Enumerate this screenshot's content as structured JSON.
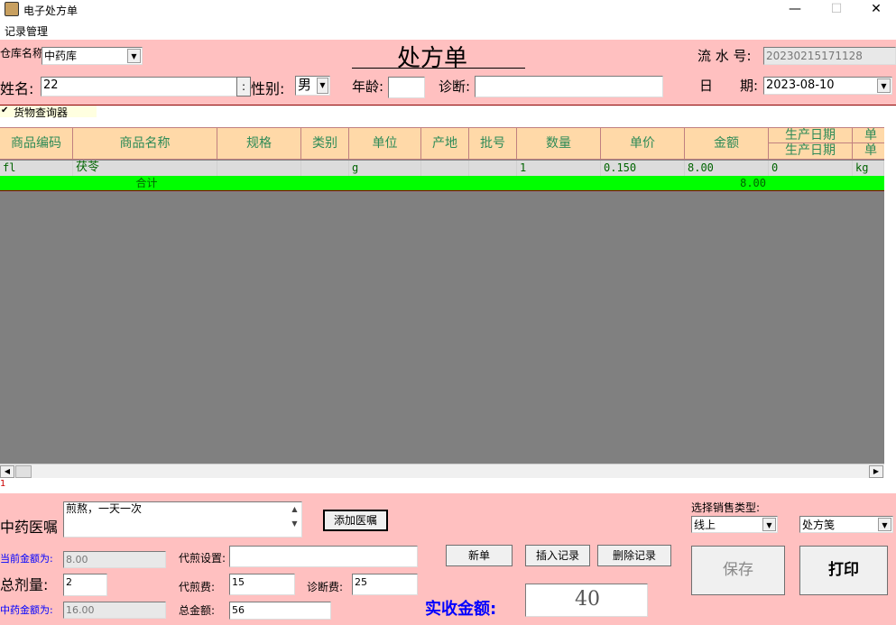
{
  "window": {
    "title": "电子处方单",
    "minimize": "—",
    "maximize": "☐",
    "close": "✕"
  },
  "menu": {
    "item1": "记录管理"
  },
  "form": {
    "warehouse_label": "仓库名称",
    "warehouse_value": "中药库",
    "heading": "处方单",
    "serial_label": "流 水 号:",
    "serial_value": "20230215171128",
    "name_label": "姓名:",
    "name_value": "22",
    "name_btn": ":",
    "gender_label": "性别:",
    "gender_value": "男",
    "age_label": "年龄:",
    "age_value": "",
    "diagnosis_label": "诊断:",
    "diagnosis_value": "",
    "date_label_1": "日",
    "date_label_2": "期:",
    "date_value": "2023-08-10",
    "goods_query_check": "✔",
    "goods_query_label": "货物查询器"
  },
  "grid": {
    "headers": [
      "商品编码",
      "商品名称",
      "规格",
      "类别",
      "单位",
      "产地",
      "批号",
      "数量",
      "单价",
      "金额",
      "生产日期",
      "单"
    ],
    "split_header_top": "生产日期",
    "split_header_bottom": "生产日期",
    "row1": {
      "code": "fl",
      "name": "茯苓",
      "spec": "",
      "category": "",
      "unit": "g",
      "origin": "",
      "batch": "",
      "qty": "1",
      "price": "0.150",
      "amount": "8.00",
      "prod_date": "0",
      "last": "kg"
    },
    "sum_row": {
      "label": "合计",
      "amount": "8.00"
    }
  },
  "marker": "1",
  "bottom": {
    "advice_label": "中药医嘱",
    "advice_text": "煎熬，一天一次",
    "add_advice_btn": "添加医嘱",
    "sale_type_label": "选择销售类型:",
    "sale_type_value": "线上",
    "rx_type_value": "处方笺",
    "current_amount_label": "当前金额为:",
    "current_amount_value": "8.00",
    "decoct_setting_label": "代煎设置:",
    "decoct_setting_value": "",
    "total_dose_label": "总剂量:",
    "total_dose_value": "2",
    "decoct_fee_label": "代煎费:",
    "decoct_fee_value": "15",
    "diag_fee_label": "诊断费:",
    "diag_fee_value": "25",
    "tcm_amount_label": "中药金额为:",
    "tcm_amount_value": "16.00",
    "total_amount_label": "总金额:",
    "total_amount_value": "56",
    "new_btn": "新单",
    "insert_btn": "插入记录",
    "delete_btn": "删除记录",
    "save_btn": "保存",
    "print_btn": "打印",
    "received_label": "实收金额:",
    "received_value": "40"
  }
}
